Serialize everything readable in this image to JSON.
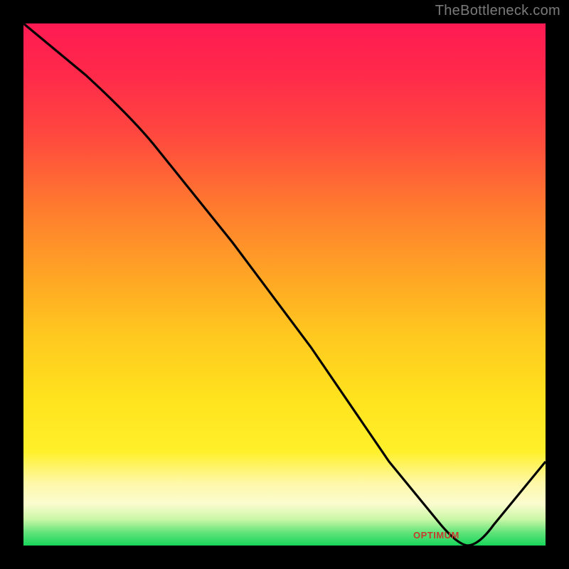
{
  "source_label": "TheBottleneck.com",
  "optimum_label": "OPTIMUM",
  "chart_data": {
    "type": "line",
    "title": "",
    "xlabel": "",
    "ylabel": "",
    "xlim": [
      0,
      100
    ],
    "ylim": [
      0,
      100
    ],
    "series": [
      {
        "name": "curve",
        "x": [
          0,
          12,
          25,
          40,
          55,
          70,
          80,
          85,
          90,
          100
        ],
        "y": [
          100,
          90,
          80,
          58,
          38,
          16,
          4,
          0,
          4,
          16
        ]
      }
    ],
    "annotations": [
      {
        "name": "optimum",
        "x": 85,
        "y": 0,
        "text": "OPTIMUM"
      }
    ],
    "background_gradient": {
      "direction": "vertical",
      "stops": [
        {
          "pos": 0.0,
          "color": "#ff1a53"
        },
        {
          "pos": 0.5,
          "color": "#ffb520"
        },
        {
          "pos": 0.82,
          "color": "#fff02a"
        },
        {
          "pos": 0.92,
          "color": "#fbfccf"
        },
        {
          "pos": 1.0,
          "color": "#17d65a"
        }
      ]
    }
  }
}
